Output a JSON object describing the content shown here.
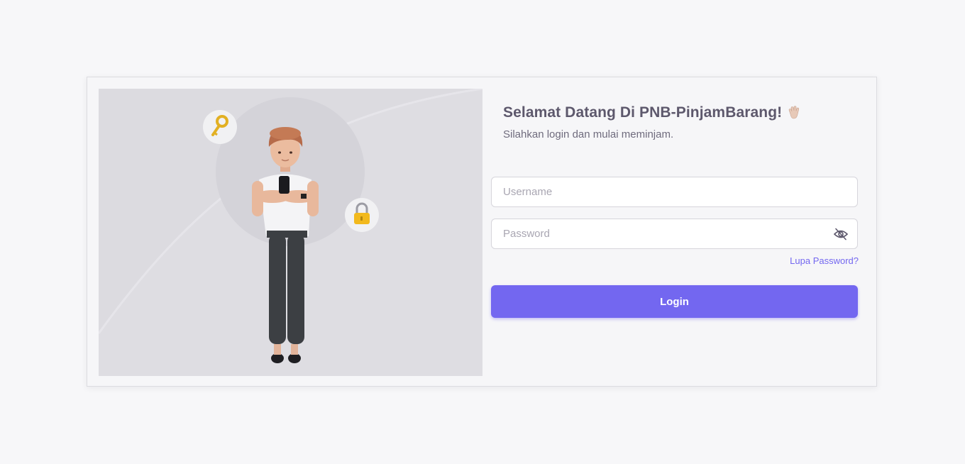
{
  "login": {
    "title": "Selamat Datang Di PNB-PinjamBarang!",
    "subtitle": "Silahkan login dan mulai meminjam.",
    "username_placeholder": "Username",
    "password_placeholder": "Password",
    "forgot_label": "Lupa Password?",
    "login_label": "Login"
  },
  "icons": {
    "title_emoji": "waving-hand-icon",
    "password_toggle": "eye-off-icon",
    "badge_left": "key-icon",
    "badge_right": "lock-icon"
  },
  "colors": {
    "primary": "#7367f0",
    "text": "#5d586c",
    "illustration_bg": "#dcdbe0"
  }
}
